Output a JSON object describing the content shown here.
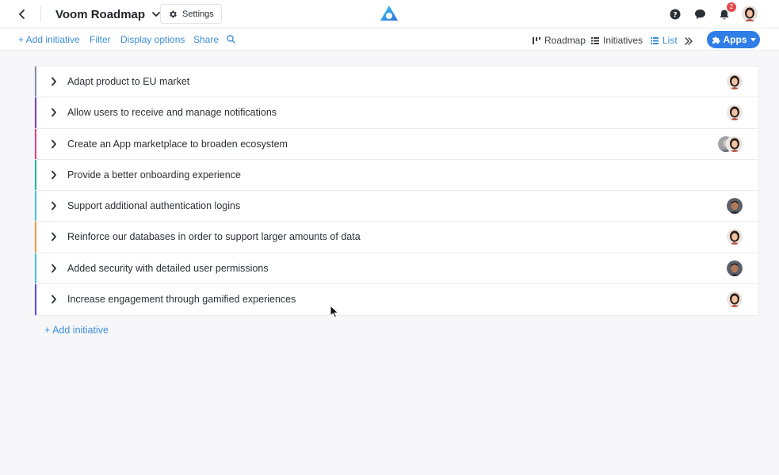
{
  "header": {
    "title": "Voom Roadmap",
    "settings_label": "Settings",
    "notification_count": "2"
  },
  "toolbar": {
    "add_initiative": "+ Add initiative",
    "filter": "Filter",
    "display_options": "Display options",
    "share": "Share",
    "views": [
      {
        "label": "Roadmap",
        "icon": "roadmap-icon",
        "active": false
      },
      {
        "label": "Initiatives",
        "icon": "list-icon",
        "active": false
      },
      {
        "label": "List",
        "icon": "list-icon",
        "active": true
      }
    ],
    "apps_label": "Apps"
  },
  "initiatives": [
    {
      "label": "Adapt product to EU market",
      "color": "#8a8fa8",
      "avatars": [
        "woman"
      ]
    },
    {
      "label": "Allow users to receive and manage notifications",
      "color": "#7b3fbf",
      "avatars": [
        "woman"
      ]
    },
    {
      "label": "Create an App marketplace to broaden ecosystem",
      "color": "#e0438a",
      "avatars": [
        "gray",
        "woman"
      ]
    },
    {
      "label": "Provide a better onboarding experience",
      "color": "#21b5a3",
      "avatars": []
    },
    {
      "label": "Support additional authentication logins",
      "color": "#4cc0e0",
      "avatars": [
        "man"
      ]
    },
    {
      "label": "Reinforce our databases in order to support larger amounts of data",
      "color": "#f09a3e",
      "avatars": [
        "woman"
      ]
    },
    {
      "label": "Added security with detailed user permissions",
      "color": "#4cc0e0",
      "avatars": [
        "man"
      ]
    },
    {
      "label": "Increase engagement through gamified experiences",
      "color": "#5a4fcf",
      "avatars": [
        "woman"
      ]
    }
  ],
  "add_initiative_bottom": "+ Add initiative",
  "colors": {
    "accent": "#3e8ed8",
    "apps_button": "#2f7ee6",
    "badge": "#e5484d"
  }
}
